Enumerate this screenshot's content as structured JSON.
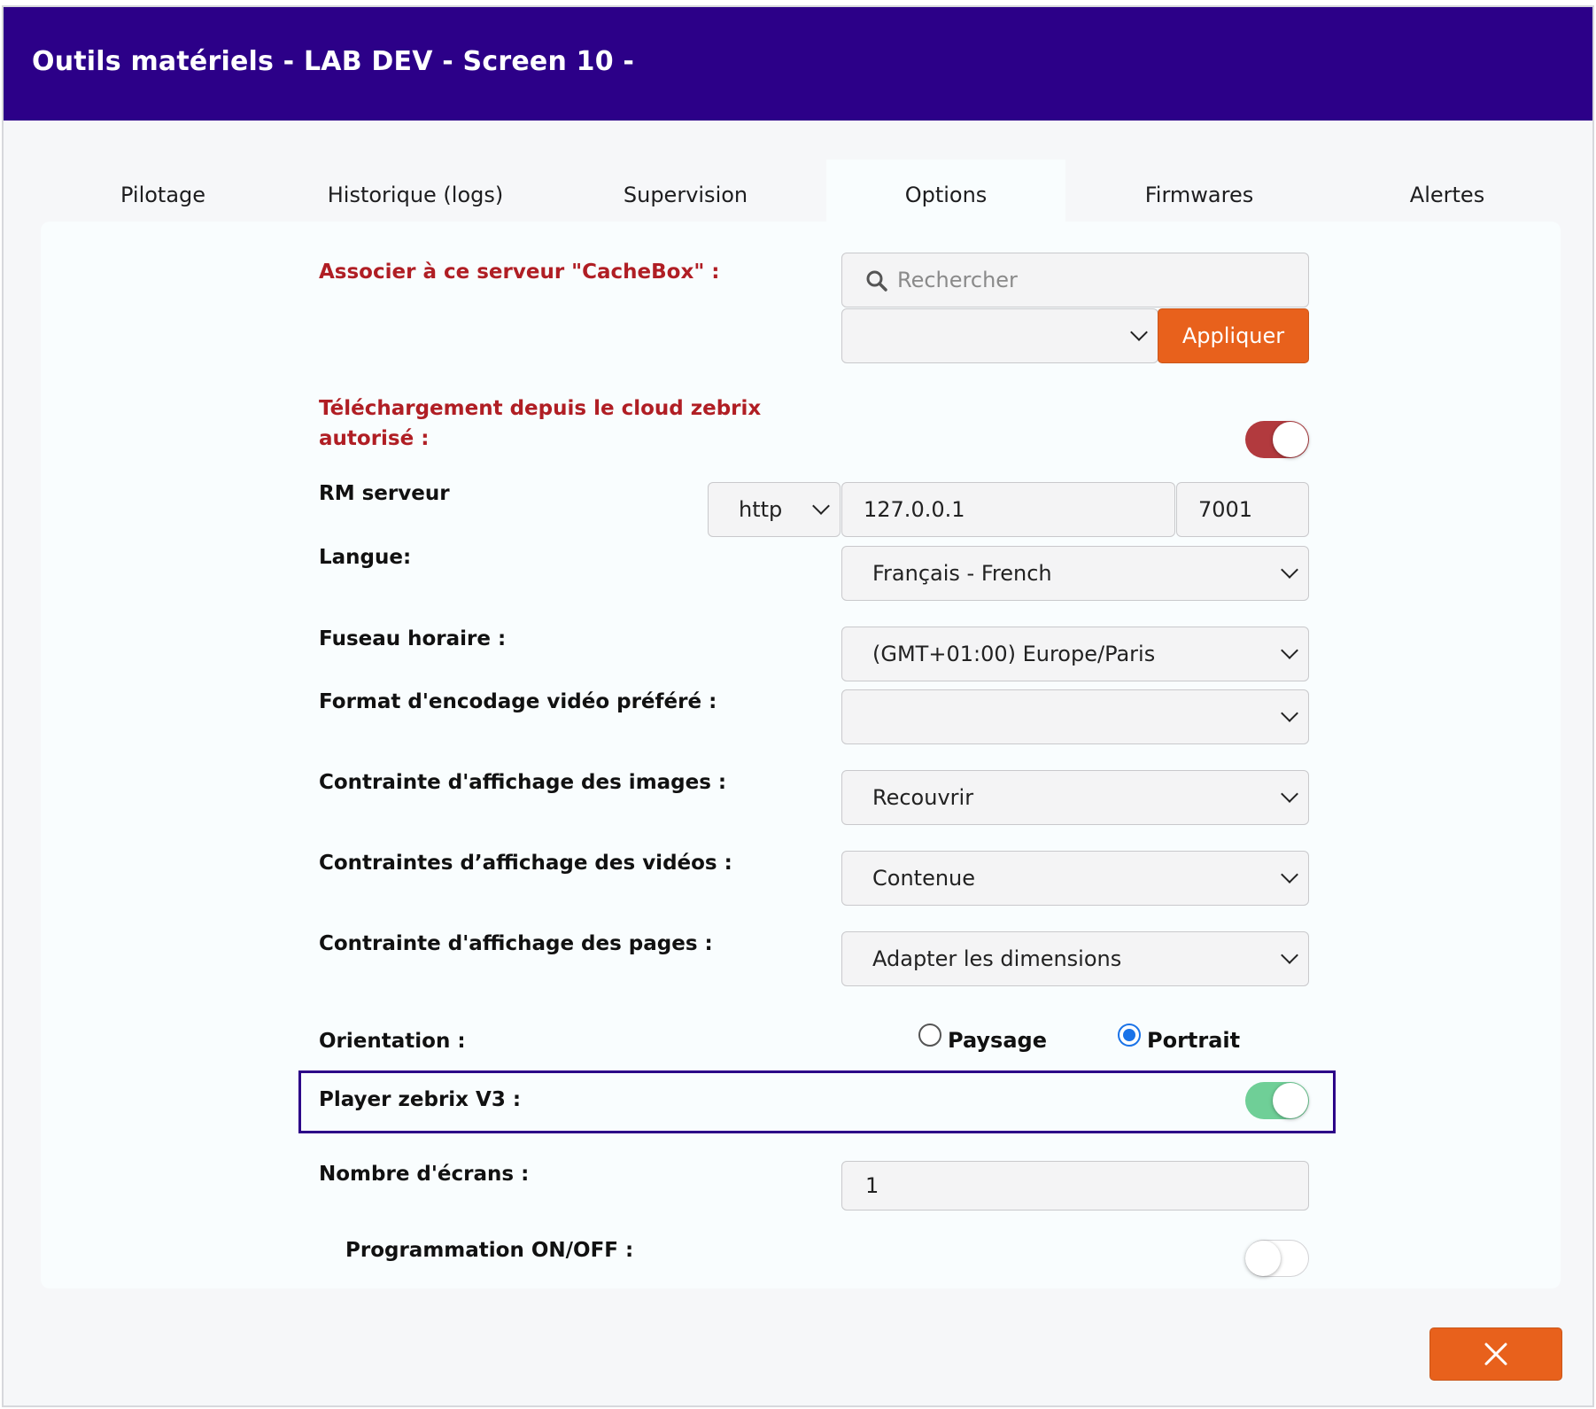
{
  "header": {
    "title": "Outils matériels - LAB DEV - Screen 10 -"
  },
  "tabs": [
    {
      "label": "Pilotage"
    },
    {
      "label": "Historique (logs)"
    },
    {
      "label": "Supervision"
    },
    {
      "label": "Options",
      "active": true
    },
    {
      "label": "Firmwares"
    },
    {
      "label": "Alertes"
    }
  ],
  "options": {
    "cachebox": {
      "label": "Associer à ce serveur \"CacheBox\" :",
      "search_placeholder": "Rechercher",
      "select_value": "",
      "apply_label": "Appliquer"
    },
    "cloud_download": {
      "label_line1": "Téléchargement depuis le cloud zebrix",
      "label_line2": "autorisé :",
      "enabled": true
    },
    "rm_server": {
      "label": "RM serveur",
      "protocol": "http",
      "host": "127.0.0.1",
      "port": "7001"
    },
    "language": {
      "label": "Langue:",
      "value": "Français - French"
    },
    "timezone": {
      "label": "Fuseau horaire :",
      "value": "(GMT+01:00) Europe/Paris"
    },
    "video_format": {
      "label": "Format d'encodage vidéo préféré :",
      "value": ""
    },
    "image_constraint": {
      "label": "Contrainte d'affichage des images :",
      "value": "Recouvrir"
    },
    "video_constraint": {
      "label": "Contraintes d’affichage des vidéos :",
      "value": "Contenue"
    },
    "page_constraint": {
      "label": "Contrainte d'affichage des pages :",
      "value": "Adapter les dimensions"
    },
    "orientation": {
      "label": "Orientation :",
      "landscape_label": "Paysage",
      "portrait_label": "Portrait",
      "selected": "Portrait"
    },
    "player_v3": {
      "label": "Player zebrix V3 :",
      "enabled": true
    },
    "screen_count": {
      "label": "Nombre d'écrans :",
      "value": "1"
    },
    "schedule": {
      "label": "Programmation ON/OFF :",
      "enabled": false
    }
  },
  "footer": {
    "close_icon": "close-icon"
  },
  "colors": {
    "header_bg": "#2c0088",
    "accent_orange": "#e8611c",
    "label_red": "#b01e24",
    "toggle_red": "#b23a3e",
    "toggle_green": "#6fcf97",
    "radio_blue": "#1a73e8"
  }
}
